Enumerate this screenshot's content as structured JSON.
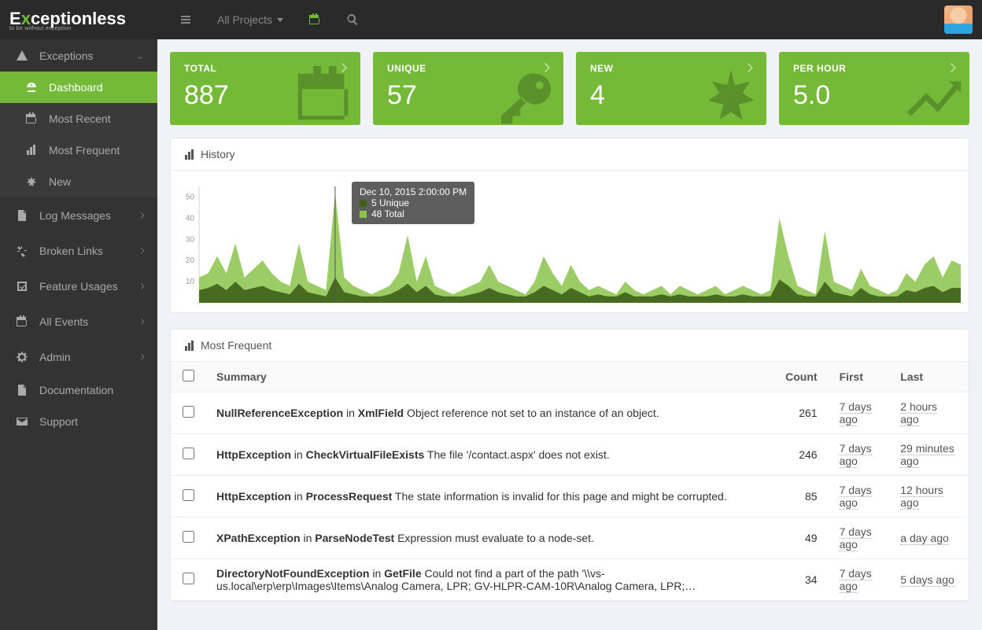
{
  "header": {
    "logo_main": "Exceptionless",
    "logo_tag": "to be without exception",
    "project_selector": "All Projects"
  },
  "sidebar": {
    "items": [
      {
        "label": "Exceptions",
        "icon": "warning-triangle",
        "open": true,
        "children": [
          {
            "label": "Dashboard",
            "icon": "gauge",
            "active": true
          },
          {
            "label": "Most Recent",
            "icon": "calendar"
          },
          {
            "label": "Most Frequent",
            "icon": "bar-chart"
          },
          {
            "label": "New",
            "icon": "asterisk"
          }
        ]
      },
      {
        "label": "Log Messages",
        "icon": "file",
        "chevron": true
      },
      {
        "label": "Broken Links",
        "icon": "unlink",
        "chevron": true
      },
      {
        "label": "Feature Usages",
        "icon": "check-square",
        "chevron": true
      },
      {
        "label": "All Events",
        "icon": "calendar",
        "chevron": true
      },
      {
        "label": "Admin",
        "icon": "gear",
        "chevron": true
      },
      {
        "label": "Documentation",
        "icon": "file"
      },
      {
        "label": "Support",
        "icon": "envelope"
      }
    ]
  },
  "stats": {
    "total": {
      "label": "TOTAL",
      "value": "887",
      "icon": "calendar"
    },
    "unique": {
      "label": "UNIQUE",
      "value": "57",
      "icon": "key"
    },
    "new": {
      "label": "NEW",
      "value": "4",
      "icon": "asterisk"
    },
    "perhour": {
      "label": "PER HOUR",
      "value": "5.0",
      "icon": "trend"
    }
  },
  "history": {
    "title": "History",
    "tooltip": {
      "timestamp": "Dec 10, 2015 2:00:00 PM",
      "unique": "5 Unique",
      "total": "48 Total"
    }
  },
  "chart_data": {
    "type": "area",
    "title": "History",
    "xlabel": "",
    "ylabel": "",
    "ylim": [
      0,
      55
    ],
    "y_ticks": [
      10,
      20,
      30,
      40,
      50
    ],
    "series": [
      {
        "name": "Total",
        "color": "#8bc34a",
        "values": [
          12,
          14,
          22,
          14,
          28,
          12,
          16,
          20,
          14,
          10,
          8,
          28,
          10,
          8,
          6,
          52,
          12,
          8,
          6,
          4,
          6,
          8,
          14,
          32,
          10,
          22,
          8,
          6,
          4,
          6,
          8,
          10,
          18,
          10,
          8,
          6,
          4,
          10,
          22,
          14,
          8,
          18,
          10,
          6,
          8,
          6,
          4,
          10,
          6,
          4,
          6,
          8,
          4,
          8,
          6,
          4,
          6,
          8,
          4,
          6,
          8,
          6,
          4,
          6,
          40,
          22,
          8,
          6,
          4,
          34,
          10,
          8,
          6,
          16,
          8,
          6,
          4,
          6,
          14,
          10,
          18,
          22,
          12,
          20,
          18
        ]
      },
      {
        "name": "Unique",
        "color": "#3d611a",
        "values": [
          6,
          7,
          9,
          6,
          10,
          6,
          7,
          8,
          6,
          5,
          4,
          9,
          5,
          4,
          3,
          12,
          5,
          4,
          3,
          3,
          3,
          4,
          6,
          9,
          5,
          8,
          4,
          3,
          3,
          3,
          4,
          5,
          7,
          5,
          4,
          3,
          3,
          5,
          8,
          6,
          4,
          7,
          5,
          3,
          4,
          3,
          3,
          5,
          3,
          3,
          3,
          4,
          3,
          4,
          3,
          3,
          3,
          4,
          3,
          3,
          4,
          3,
          3,
          3,
          11,
          8,
          4,
          3,
          3,
          10,
          5,
          4,
          3,
          7,
          4,
          3,
          3,
          3,
          6,
          5,
          7,
          8,
          5,
          7,
          7
        ]
      }
    ],
    "highlight_index": 15
  },
  "most_frequent": {
    "title": "Most Frequent",
    "columns": {
      "summary": "Summary",
      "count": "Count",
      "first": "First",
      "last": "Last"
    },
    "rows": [
      {
        "exception": "NullReferenceException",
        "method": "XmlField",
        "message": "Object reference not set to an instance of an object.",
        "count": 261,
        "first": "7 days ago",
        "last": "2 hours ago"
      },
      {
        "exception": "HttpException",
        "method": "CheckVirtualFileExists",
        "message": "The file '/contact.aspx' does not exist.",
        "count": 246,
        "first": "7 days ago",
        "last": "29 minutes ago"
      },
      {
        "exception": "HttpException",
        "method": "ProcessRequest",
        "message": "The state information is invalid for this page and might be corrupted.",
        "count": 85,
        "first": "7 days ago",
        "last": "12 hours ago"
      },
      {
        "exception": "XPathException",
        "method": "ParseNodeTest",
        "message": "Expression must evaluate to a node-set.",
        "count": 49,
        "first": "7 days ago",
        "last": "a day ago"
      },
      {
        "exception": "DirectoryNotFoundException",
        "method": "GetFile",
        "message": "Could not find a part of the path '\\\\vs-us.local\\erp\\erp\\Images\\Items\\Analog Camera, LPR; GV-HLPR-CAM-10R\\Analog Camera, LPR;…",
        "count": 34,
        "first": "7 days ago",
        "last": "5 days ago"
      }
    ]
  }
}
